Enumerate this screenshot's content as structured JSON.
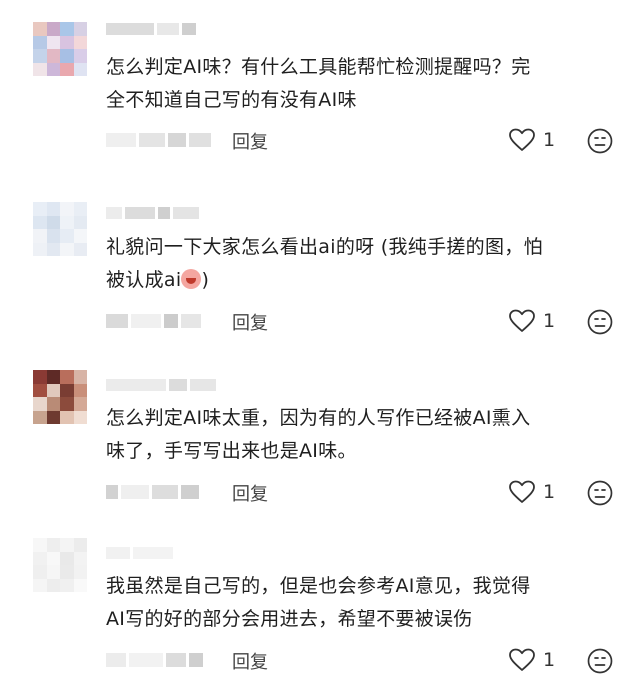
{
  "comments": [
    {
      "text_lines": [
        "怎么判定AI味？有什么工具能帮忙检测提醒吗？完",
        "全不知道自己写的有没有AI味"
      ],
      "reply_label": "回复",
      "like_count": "1",
      "avatar_colors": [
        "#e9c8c0",
        "#c9a9c8",
        "#a9c6e8",
        "#d7d0e4",
        "#b6c9e6",
        "#efe5f0",
        "#d8c3e0",
        "#f3d7d9",
        "#c4d3ea",
        "#e2b8c4",
        "#a7bfe4",
        "#d9cde8",
        "#f0e4e8",
        "#cdb7d9",
        "#e9a8ae",
        "#dfe3f2"
      ]
    },
    {
      "text_lines": [
        "礼貌问一下大家怎么看出ai的呀 (我纯手搓的图，怕",
        "被认成ai"
      ],
      "text_suffix": ")",
      "reply_label": "回复",
      "like_count": "1",
      "avatar_colors": [
        "#e8eef6",
        "#dfe7f2",
        "#f2f4f8",
        "#e9eef5",
        "#dde6f1",
        "#cfdbe9",
        "#eef2f7",
        "#e4eaf2",
        "#f1f3f7",
        "#d9e2ee",
        "#e6ecf4",
        "#f4f6f9",
        "#eef1f6",
        "#e2e8f1",
        "#f3f5f8",
        "#e8ecf3"
      ]
    },
    {
      "text_lines": [
        "怎么判定AI味太重，因为有的人写作已经被AI熏入",
        "味了，手写写出来也是AI味。"
      ],
      "reply_label": "回复",
      "like_count": "1",
      "avatar_colors": [
        "#8a3a34",
        "#5e2a26",
        "#b96e5c",
        "#d8b4a6",
        "#a14e40",
        "#e0c9bd",
        "#7a3d33",
        "#c98f7a",
        "#e8d6cc",
        "#b98b76",
        "#8c4b3c",
        "#d4a996",
        "#c7a38e",
        "#6e3a30",
        "#e2c3b2",
        "#f0ddd2"
      ]
    },
    {
      "text_lines": [
        "我虽然是自己写的，但是也会参考AI意见，我觉得",
        "AI写的好的部分会用进去，希望不要被误伤"
      ],
      "reply_label": "回复",
      "like_count": "1",
      "avatar_colors": [
        "#f7f7f7",
        "#eeeeee",
        "#f4f4f4",
        "#ececec",
        "#f1f1f1",
        "#f8f8f8",
        "#e9e9e9",
        "#f3f3f3",
        "#efefef",
        "#f6f6f6",
        "#eaeaea",
        "#f2f2f2",
        "#f5f5f5",
        "#ededed",
        "#f0f0f0",
        "#f9f9f9"
      ]
    }
  ],
  "icons": {
    "like": "heart-outline-icon",
    "dislike": "frown-face-icon"
  }
}
